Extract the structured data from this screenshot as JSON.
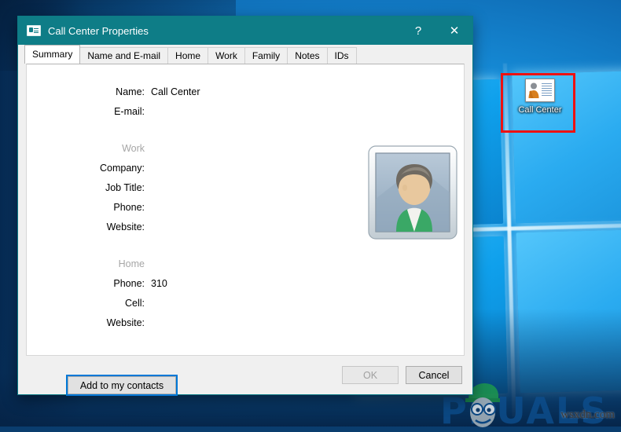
{
  "window": {
    "title": "Call Center Properties",
    "icon": "contact-card-icon",
    "titlebar_color": "#0e7d87",
    "help_button": "?",
    "close_button": "✕"
  },
  "tabs": [
    {
      "label": "Summary",
      "active": true
    },
    {
      "label": "Name and E-mail",
      "active": false
    },
    {
      "label": "Home",
      "active": false
    },
    {
      "label": "Work",
      "active": false
    },
    {
      "label": "Family",
      "active": false
    },
    {
      "label": "Notes",
      "active": false
    },
    {
      "label": "IDs",
      "active": false
    }
  ],
  "summary": {
    "top_fields": [
      {
        "label": "Name:",
        "value": "Call Center"
      },
      {
        "label": "E-mail:",
        "value": ""
      }
    ],
    "work_section": {
      "heading": "Work",
      "fields": [
        {
          "label": "Company:",
          "value": ""
        },
        {
          "label": "Job Title:",
          "value": ""
        },
        {
          "label": "Phone:",
          "value": ""
        },
        {
          "label": "Website:",
          "value": ""
        }
      ]
    },
    "home_section": {
      "heading": "Home",
      "fields": [
        {
          "label": "Phone:",
          "value": "310"
        },
        {
          "label": "Cell:",
          "value": ""
        },
        {
          "label": "Website:",
          "value": ""
        }
      ]
    },
    "avatar_alt": "default-contact-photo",
    "add_contacts_label": "Add to my contacts"
  },
  "footer": {
    "ok_label": "OK",
    "ok_disabled": true,
    "cancel_label": "Cancel"
  },
  "desktop": {
    "icon": {
      "label": "Call Center",
      "glyph": "contact-card-icon"
    },
    "annotation_color": "#ee1111",
    "watermark": {
      "brand": "PPUALS",
      "site": "wsxdn.com"
    }
  }
}
